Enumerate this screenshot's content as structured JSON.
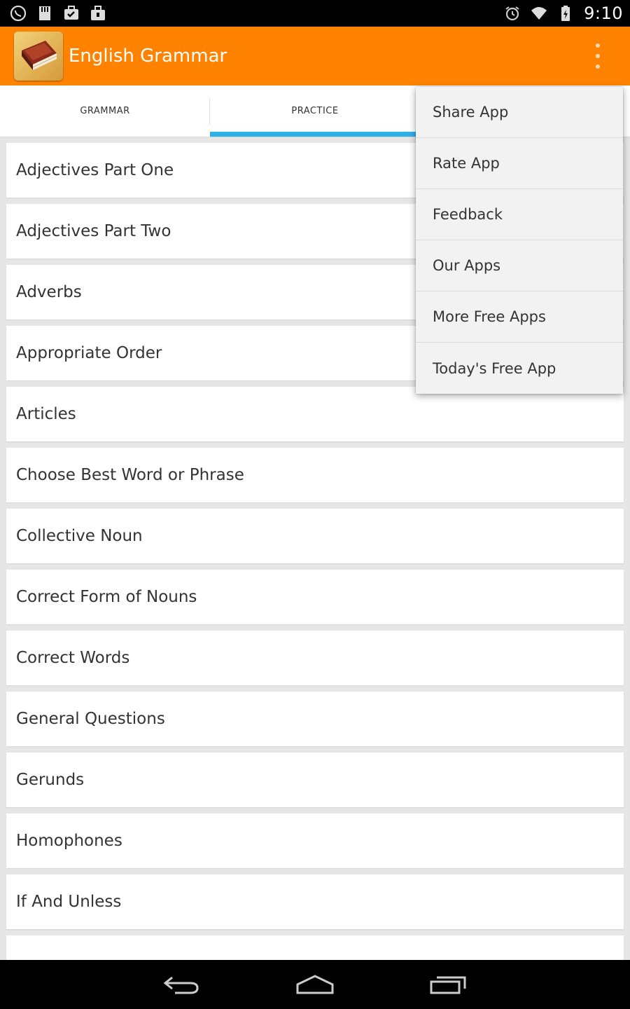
{
  "status_bar": {
    "time": "9:10",
    "left_icons": [
      "viber-icon",
      "sd-card-icon",
      "briefcase-check-icon",
      "shopping-bag-icon"
    ],
    "right_icons": [
      "alarm-icon",
      "wifi-icon",
      "battery-icon"
    ]
  },
  "action_bar": {
    "title": "English Grammar",
    "icon": "book-icon",
    "background_color": "#ff8300"
  },
  "tabs": [
    {
      "label": "GRAMMAR",
      "active": false
    },
    {
      "label": "PRACTICE",
      "active": true
    },
    {
      "label": "",
      "active": false
    }
  ],
  "tab_accent_color": "#30b0e8",
  "list": {
    "items": [
      "Adjectives Part One",
      "Adjectives Part Two",
      "Adverbs",
      "Appropriate Order",
      "Articles",
      "Choose Best Word or Phrase",
      "Collective Noun",
      "Correct Form of Nouns",
      "Correct Words",
      "General Questions",
      "Gerunds",
      "Homophones",
      "If And Unless",
      ""
    ]
  },
  "overflow_menu": {
    "items": [
      "Share App",
      "Rate App",
      "Feedback",
      "Our Apps",
      "More Free Apps",
      "Today's Free App"
    ]
  },
  "nav_bar": {
    "buttons": [
      "back-icon",
      "home-icon",
      "recent-apps-icon"
    ]
  }
}
